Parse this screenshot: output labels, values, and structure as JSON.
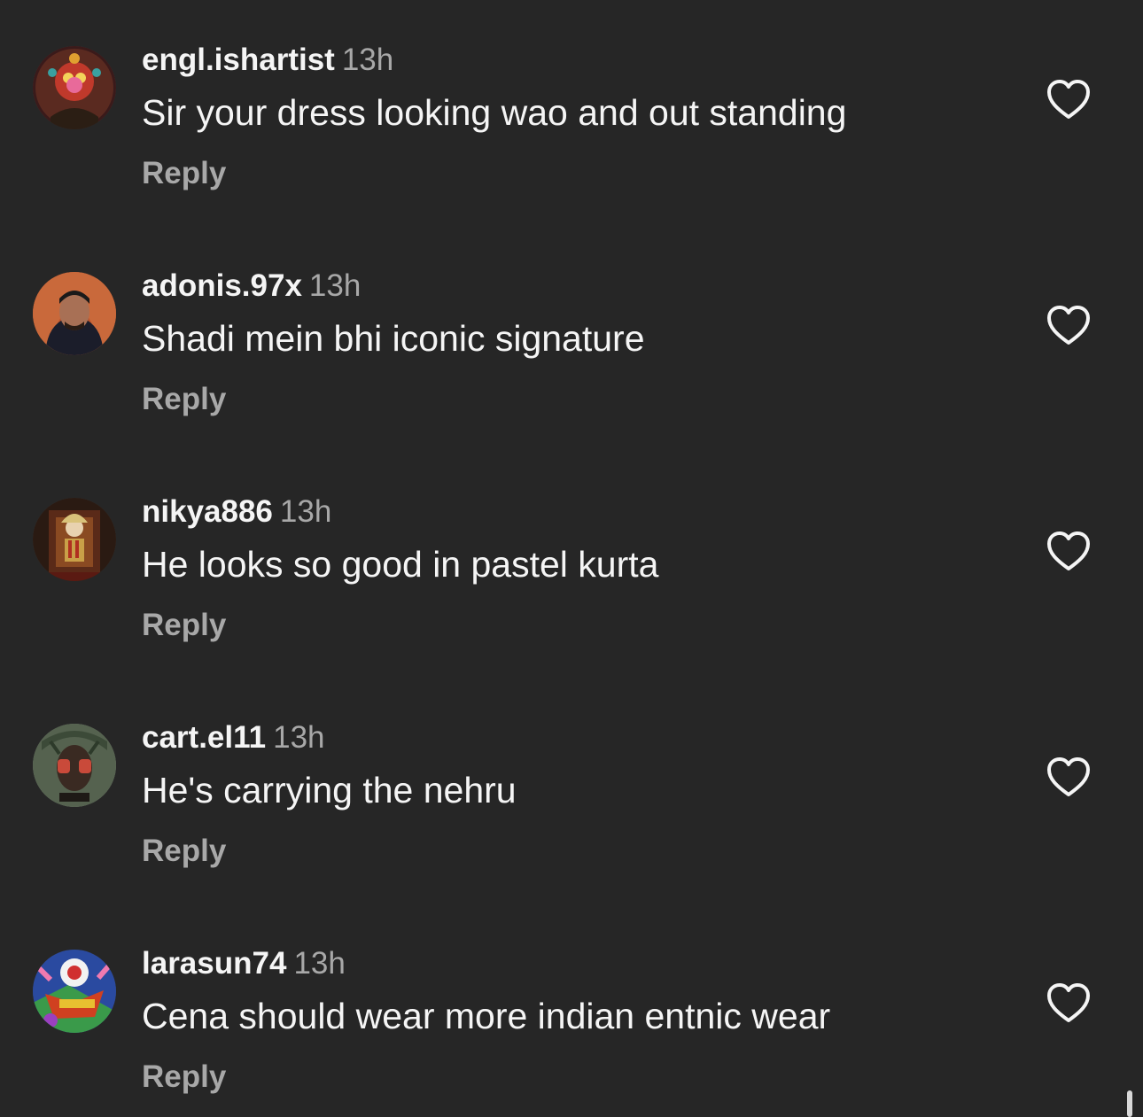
{
  "comments": [
    {
      "username": "engl.ishartist",
      "time": "13h",
      "text": "Sir your dress looking wao and out standing",
      "reply_label": "Reply",
      "like_icon": "heart-outline-icon"
    },
    {
      "username": "adonis.97x",
      "time": "13h",
      "text": "Shadi mein bhi iconic signature",
      "reply_label": "Reply",
      "like_icon": "heart-outline-icon"
    },
    {
      "username": "nikya886",
      "time": "13h",
      "text": "He looks so good in pastel kurta",
      "reply_label": "Reply",
      "like_icon": "heart-outline-icon"
    },
    {
      "username": "cart.el11",
      "time": "13h",
      "text": "He's carrying the nehru",
      "reply_label": "Reply",
      "like_icon": "heart-outline-icon"
    },
    {
      "username": "larasun74",
      "time": "13h",
      "text": "Cena should wear more indian entnic wear",
      "reply_label": "Reply",
      "like_icon": "heart-outline-icon"
    }
  ],
  "colors": {
    "background": "#262626",
    "primary_text": "#f5f5f5",
    "secondary_text": "#a8a8a8"
  }
}
